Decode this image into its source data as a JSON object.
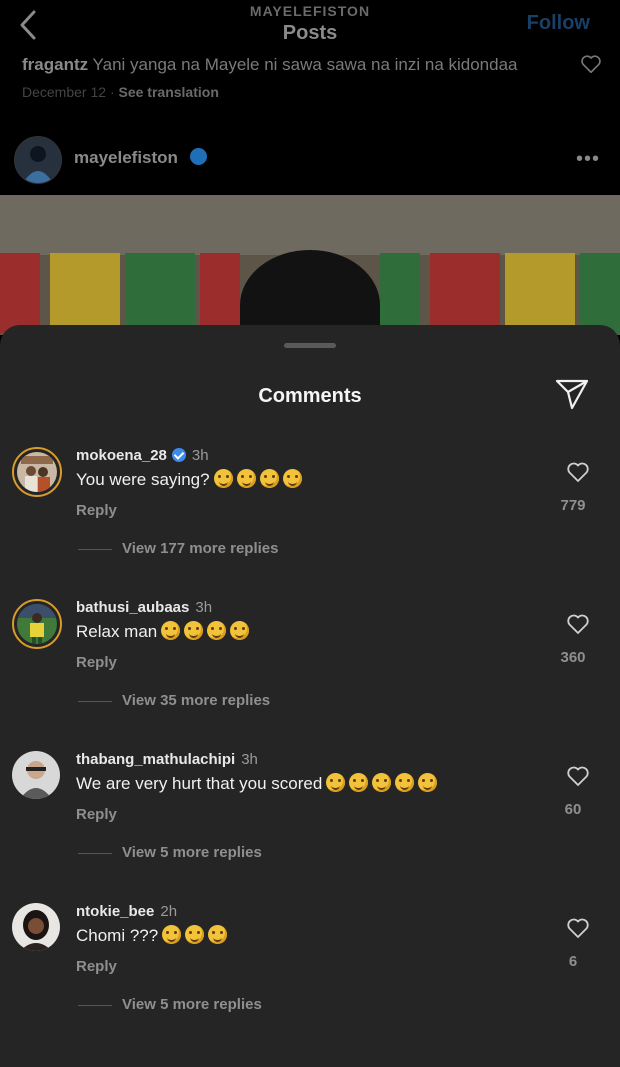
{
  "header": {
    "account_name": "MAYELEFISTON",
    "title": "Posts",
    "follow_label": "Follow"
  },
  "caption": {
    "user": "fragantz",
    "text": "Yani yanga na Mayele ni sawa sawa na inzi na kidondaa",
    "date": "December 12",
    "see_translation": "See translation"
  },
  "author": {
    "name": "mayelefiston",
    "more_icon": "more-dots-icon"
  },
  "comments_sheet": {
    "title": "Comments",
    "share_icon": "send-icon"
  },
  "comments": [
    {
      "user": "mokoena_28",
      "verified": true,
      "time": "3h",
      "text": "You were saying?",
      "emoji_count": 4,
      "reply_label": "Reply",
      "likes": "779",
      "view_replies": "View 177 more replies"
    },
    {
      "user": "bathusi_aubaas",
      "verified": false,
      "time": "3h",
      "text": "Relax man",
      "emoji_count": 4,
      "reply_label": "Reply",
      "likes": "360",
      "view_replies": "View 35 more replies"
    },
    {
      "user": "thabang_mathulachipi",
      "verified": false,
      "time": "3h",
      "text": "We are very hurt that you scored",
      "emoji_count": 5,
      "reply_label": "Reply",
      "likes": "60",
      "view_replies": "View 5 more replies"
    },
    {
      "user": "ntokie_bee",
      "verified": false,
      "time": "2h",
      "text": "Chomi ???",
      "emoji_count": 3,
      "reply_label": "Reply",
      "likes": "6",
      "view_replies": "View 5 more replies"
    }
  ],
  "colors": {
    "sheet_bg": "#252525",
    "link_blue": "#1a3f66",
    "verified_blue": "#3b8beb"
  }
}
